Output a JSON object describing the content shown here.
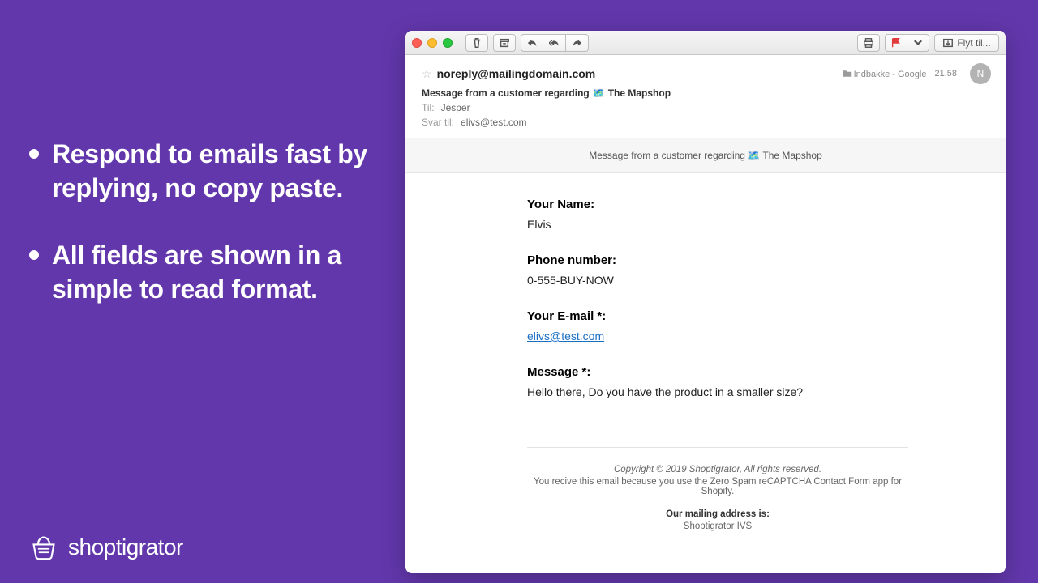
{
  "marketing": {
    "bullets": [
      "Respond to emails fast by replying, no copy paste.",
      "All fields are shown in a simple to read format."
    ],
    "brand": "shoptigrator"
  },
  "toolbar": {
    "move_label": "Flyt til..."
  },
  "header": {
    "from": "noreply@mailingdomain.com",
    "subject_prefix": "Message from a customer regarding",
    "shop_name": "The Mapshop",
    "folder": "Indbakke - Google",
    "time": "21.58",
    "avatar_initial": "N",
    "to_label": "Til:",
    "to_value": "Jesper",
    "reply_to_label": "Svar til:",
    "reply_to_value": "elivs@test.com"
  },
  "banner": {
    "prefix": "Message from a customer regarding",
    "shop_name": "The Mapshop"
  },
  "body": {
    "fields": [
      {
        "label": "Your Name:",
        "value": "Elvis",
        "link": false
      },
      {
        "label": "Phone number:",
        "value": "0-555-BUY-NOW",
        "link": false
      },
      {
        "label": "Your E-mail *:",
        "value": "elivs@test.com",
        "link": true
      },
      {
        "label": "Message *:",
        "value": "Hello there, Do you have the product in a smaller size?",
        "link": false
      }
    ]
  },
  "footer": {
    "copyright": "Copyright © 2019 Shoptigrator, All rights reserved.",
    "reason": "You recive this email because you use the Zero Spam reCAPTCHA Contact Form app for Shopify.",
    "addr_title": "Our mailing address is:",
    "addr_line1": "Shoptigrator IVS"
  }
}
